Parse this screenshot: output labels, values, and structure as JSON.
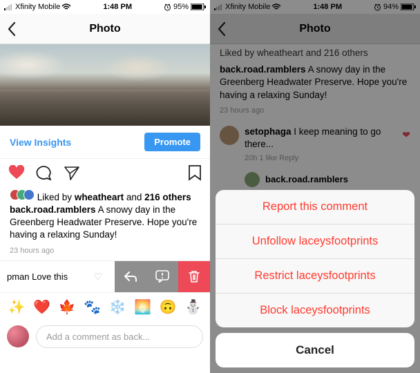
{
  "left": {
    "status": {
      "carrier": "Xfinity Mobile",
      "time": "1:48 PM",
      "battery": "95%"
    },
    "nav": {
      "title": "Photo"
    },
    "insights": {
      "view": "View Insights",
      "promote": "Promote"
    },
    "likes": {
      "prefix": "Liked by ",
      "user": "wheatheart",
      "and": " and ",
      "count": "216 others"
    },
    "caption": {
      "user": "back.road.ramblers",
      "text": " A snowy day in the Greenberg Headwater Preserve. Hope you're having a relaxing Sunday!",
      "time": "23 hours ago"
    },
    "swipe": {
      "user": "pman",
      "text": " Love this"
    },
    "emoji": [
      "✨",
      "❤️",
      "🍁",
      "🐾",
      "❄️",
      "🌅",
      "🙃",
      "⛄"
    ],
    "compose": {
      "placeholder": "Add a comment as back..."
    }
  },
  "right": {
    "status": {
      "carrier": "Xfinity Mobile",
      "time": "1:48 PM",
      "battery": "94%"
    },
    "nav": {
      "title": "Photo"
    },
    "bg": {
      "likeline_prefix": "Liked by ",
      "likeline_user": "wheatheart",
      "likeline_rest": " and 216 others",
      "user": "back.road.ramblers",
      "text": " A snowy day in the Greenberg Headwater Preserve. Hope you're having a relaxing Sunday!",
      "time": "23 hours ago",
      "c1_user": "setophaga",
      "c1_text": " I keep meaning to go there...",
      "c1_meta": "20h    1 like    Reply",
      "reply_user": "back.road.ramblers"
    },
    "sheet": {
      "report": "Report this comment",
      "unfollow": "Unfollow laceysfootprints",
      "restrict": "Restrict laceysfootprints",
      "block": "Block laceysfootprints",
      "cancel": "Cancel"
    }
  }
}
